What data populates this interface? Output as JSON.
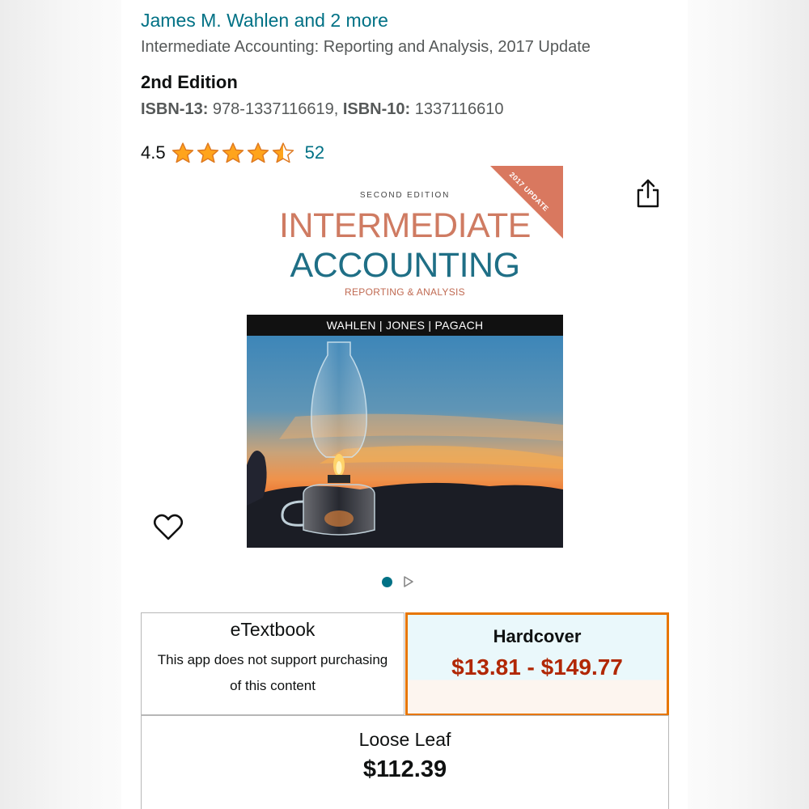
{
  "product": {
    "author": "James M. Wahlen and 2 more",
    "title": "Intermediate Accounting: Reporting and Analysis, 2017 Update",
    "edition": "2nd Edition",
    "isbn13_label": "ISBN-13:",
    "isbn13_value": "978-1337116619",
    "isbn_separator": ",",
    "isbn10_label": "ISBN-10:",
    "isbn10_value": "1337116610"
  },
  "rating": {
    "value": "4.5",
    "stars": 4.5,
    "count": "52",
    "star_color": "#ffa41c"
  },
  "cover": {
    "ribbon": "2017 UPDATE",
    "edition_line": "SECOND EDITION",
    "title_line1": "INTERMEDIATE",
    "title_line2": "ACCOUNTING",
    "subtitle": "REPORTING & ANALYSIS",
    "authors_band": "WAHLEN | JONES | PAGACH"
  },
  "actions": {
    "share_icon": "share-icon",
    "wishlist_icon": "heart-icon"
  },
  "carousel": {
    "active_dot_color": "#007185",
    "next_icon": "play-triangle-icon"
  },
  "formats": {
    "etextbook": {
      "name": "eTextbook",
      "note_line1": "This app does not support purchasing",
      "note_line2": "of this content"
    },
    "hardcover": {
      "name": "Hardcover",
      "price": "$13.81 - $149.77",
      "selected": true,
      "border_color": "#e77600",
      "price_color": "#b12704"
    },
    "loose_leaf": {
      "name": "Loose Leaf",
      "price": "$112.39"
    }
  },
  "colors": {
    "link": "#007185",
    "secondary_text": "#565959"
  }
}
